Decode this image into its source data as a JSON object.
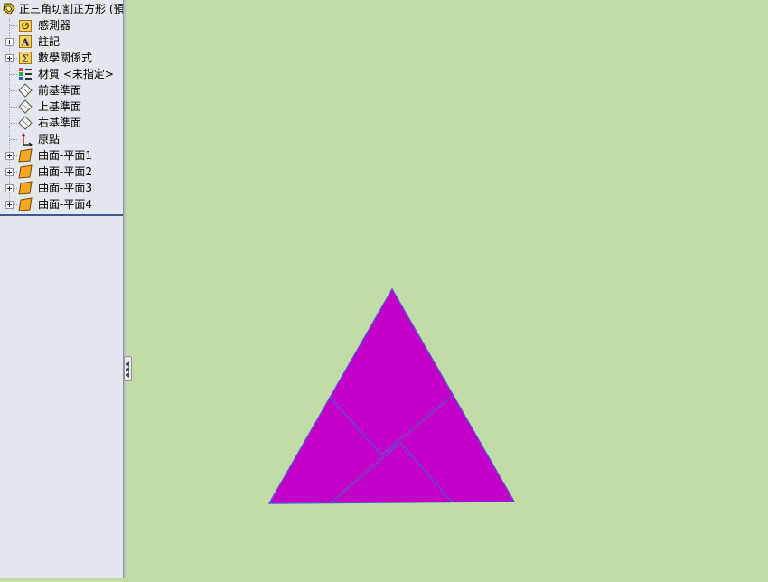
{
  "feature_tree": {
    "root_label": "正三角切割正方形 (預",
    "items": [
      {
        "label": "感測器",
        "icon": "sensors-icon",
        "expandable": false
      },
      {
        "label": "註記",
        "icon": "annotations-icon",
        "expandable": true
      },
      {
        "label": "數學關係式",
        "icon": "equations-icon",
        "expandable": true
      },
      {
        "label": "材質 <未指定>",
        "icon": "material-icon",
        "expandable": false
      },
      {
        "label": "前基準面",
        "icon": "plane-icon",
        "expandable": false
      },
      {
        "label": "上基準面",
        "icon": "plane-icon",
        "expandable": false
      },
      {
        "label": "右基準面",
        "icon": "plane-icon",
        "expandable": false
      },
      {
        "label": "原點",
        "icon": "origin-icon",
        "expandable": false
      },
      {
        "label": "曲面-平面1",
        "icon": "surface-icon",
        "expandable": true
      },
      {
        "label": "曲面-平面2",
        "icon": "surface-icon",
        "expandable": true
      },
      {
        "label": "曲面-平面3",
        "icon": "surface-icon",
        "expandable": true
      },
      {
        "label": "曲面-平面4",
        "icon": "surface-icon",
        "expandable": true
      }
    ]
  },
  "colors": {
    "viewport_background": "#c2dca8",
    "face_fill": "#c300c8",
    "edge": "#5a4fd2"
  }
}
